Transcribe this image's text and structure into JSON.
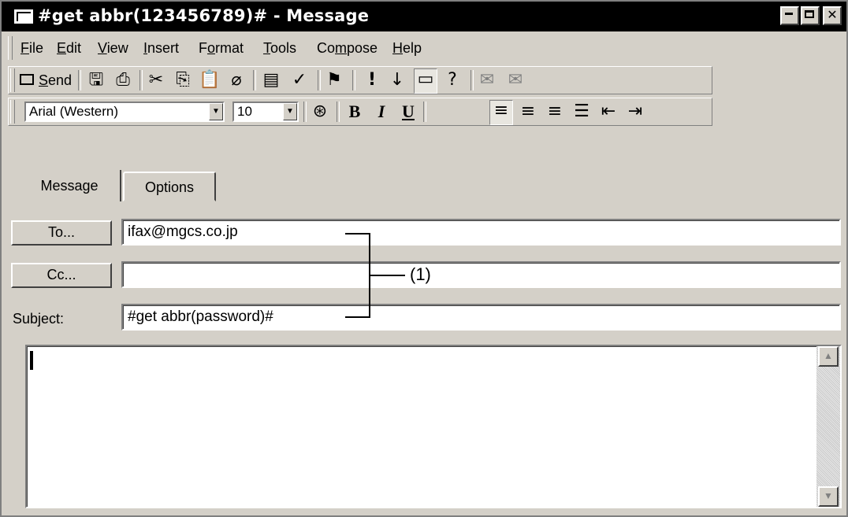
{
  "window": {
    "title": "#get abbr(123456789)# - Message",
    "controls": [
      "minimize",
      "maximize",
      "close"
    ]
  },
  "menu": [
    "File",
    "Edit",
    "View",
    "Insert",
    "Format",
    "Tools",
    "Compose",
    "Help"
  ],
  "toolbar1": {
    "send_label": "Send",
    "icons": [
      "save-icon",
      "print-icon",
      "cut-icon",
      "copy-icon",
      "paste-icon",
      "attach-icon",
      "address-book-icon",
      "check-names-icon",
      "flag-icon",
      "high-importance-icon",
      "low-importance-icon",
      "options-icon",
      "help-icon",
      "sign-icon",
      "encrypt-icon"
    ]
  },
  "toolbar2": {
    "font_name": "Arial (Western)",
    "font_size": "10",
    "bold": "B",
    "italic": "I",
    "underline": "U"
  },
  "tabs": [
    "Message",
    "Options"
  ],
  "fields": {
    "to_button": "To...",
    "to_value": "ifax@mgcs.co.jp",
    "cc_button": "Cc...",
    "cc_value": "",
    "subject_label": "Subject:",
    "subject_value": "#get abbr(password)#"
  },
  "annotation": "(1)"
}
